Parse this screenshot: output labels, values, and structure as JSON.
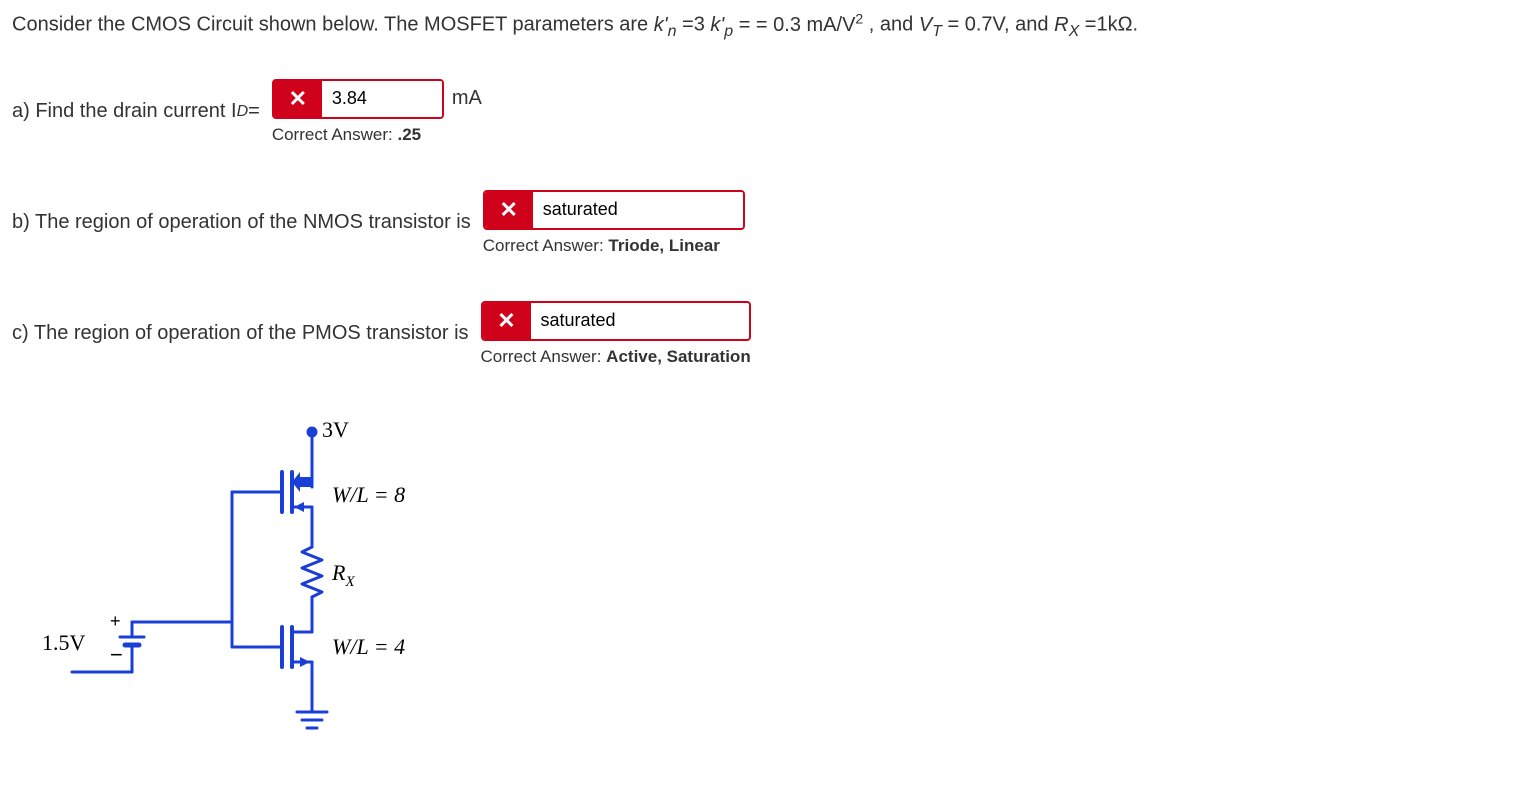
{
  "intro": {
    "prefix": "Consider the CMOS Circuit shown below. The MOSFET parameters are ",
    "kn_label": "k'",
    "kn_sub": "n",
    "eq1": "=3 ",
    "kp_label": "k'",
    "kp_sub": "p",
    "eq2": "= = 0.3 mA/V",
    "sup2": "2",
    "mid": " , and ",
    "vt_label": "V",
    "vt_sub": "T",
    "vt_val": " = 0.7V, and ",
    "rx_label": "R",
    "rx_sub": "X",
    "rx_val": "=1kΩ."
  },
  "partA": {
    "label": "a) Find the drain current  I",
    "sub": "D",
    "eq": " = ",
    "user_answer": "3.84",
    "unit": "mA",
    "correct_label": "Correct Answer: ",
    "correct_val": ".25"
  },
  "partB": {
    "label": "b) The region of operation of the NMOS transistor is ",
    "user_answer": "saturated",
    "correct_label": "Correct Answer: ",
    "correct_val": "Triode, Linear"
  },
  "partC": {
    "label": "c) The region of operation of the PMOS transistor is ",
    "user_answer": "saturated",
    "correct_label": "Correct Answer: ",
    "correct_val": "Active, Saturation"
  },
  "circuit": {
    "vdd": "3V",
    "pmos_wl": "W/L = 8",
    "rx": "R",
    "rx_sub": "X",
    "nmos_wl": "W/L = 4",
    "vin": "1.5V"
  },
  "icons": {
    "x": "✕"
  }
}
